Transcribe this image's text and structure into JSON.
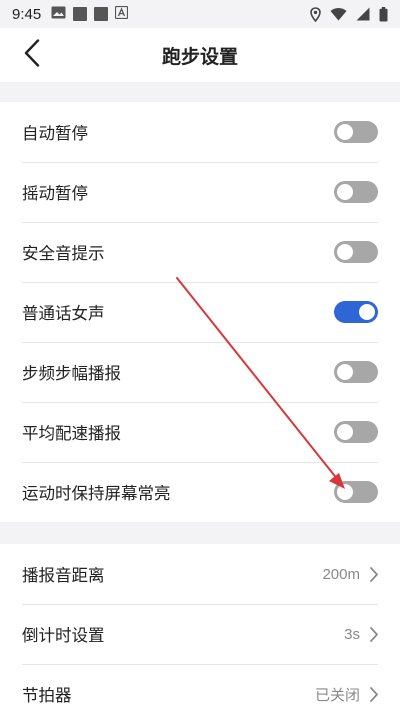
{
  "status_bar": {
    "time": "9:45",
    "icons": [
      "image-icon",
      "square-icon",
      "square-icon",
      "a-icon"
    ],
    "right_icons": [
      "location-icon",
      "wifi-icon",
      "signal-icon",
      "battery-icon"
    ]
  },
  "header": {
    "title": "跑步设置",
    "back_icon": "chevron-left-icon"
  },
  "toggles": [
    {
      "label": "自动暂停",
      "on": false
    },
    {
      "label": "摇动暂停",
      "on": false
    },
    {
      "label": "安全音提示",
      "on": false
    },
    {
      "label": "普通话女声",
      "on": true
    },
    {
      "label": "步频步幅播报",
      "on": false
    },
    {
      "label": "平均配速播报",
      "on": false
    },
    {
      "label": "运动时保持屏幕常亮",
      "on": false
    }
  ],
  "options": [
    {
      "label": "播报音距离",
      "value": "200m"
    },
    {
      "label": "倒计时设置",
      "value": "3s"
    },
    {
      "label": "节拍器",
      "value": "已关闭"
    }
  ],
  "colors": {
    "toggle_on": "#2f66d6",
    "toggle_off": "#a7a7a7",
    "annotation_arrow": "#d9383a",
    "background": "#f3f3f5"
  }
}
